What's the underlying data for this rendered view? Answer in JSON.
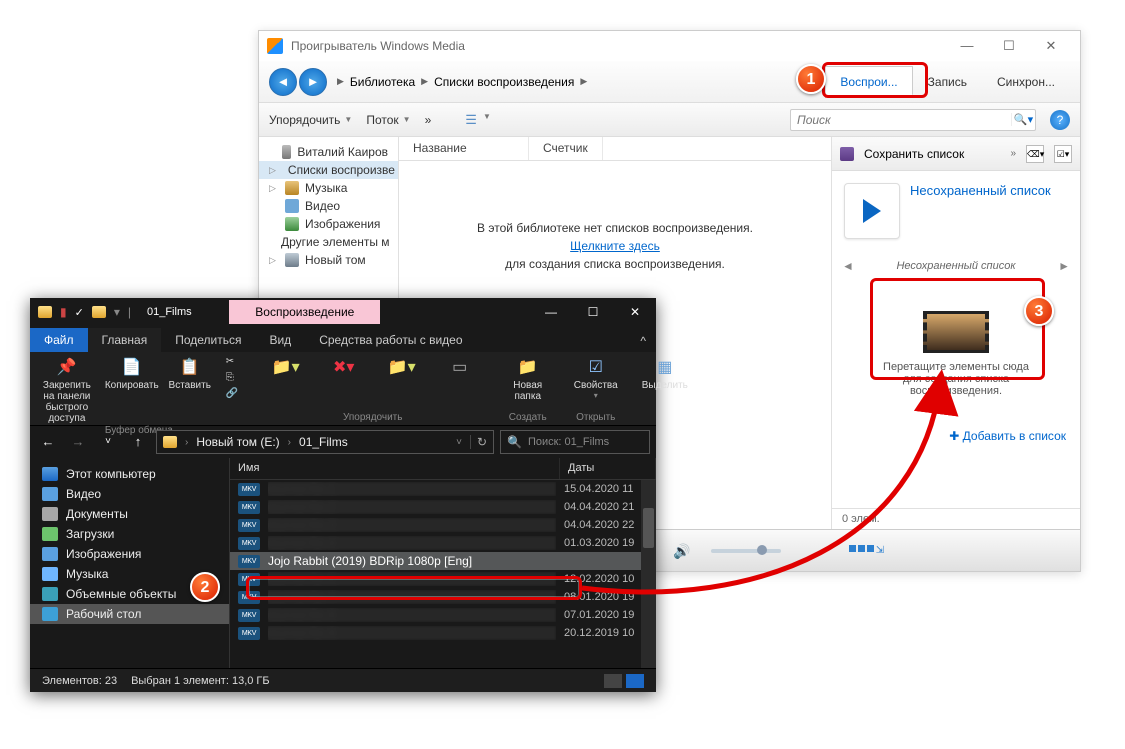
{
  "wmp": {
    "title": "Проигрыватель Windows Media",
    "breadcrumb": [
      "Библиотека",
      "Списки воспроизведения"
    ],
    "tabs": {
      "play": "Воспрои...",
      "burn": "Запись",
      "sync": "Синхрон..."
    },
    "toolbar": {
      "organize": "Упорядочить",
      "stream": "Поток",
      "more": "»",
      "search_ph": "Поиск"
    },
    "tree": {
      "user": "Виталий Каиров",
      "playlists": "Списки воспроизве",
      "music": "Музыка",
      "video": "Видео",
      "images": "Изображения",
      "other": "Другие элементы м",
      "volume": "Новый том"
    },
    "columns": {
      "name": "Название",
      "counter": "Счетчик"
    },
    "empty": {
      "line1": "В этой библиотеке нет списков воспроизведения.",
      "link": "Щелкните здесь",
      "line2": "для создания списка воспроизведения."
    },
    "right": {
      "save": "Сохранить список",
      "title": "Несохраненный список",
      "pager_label": "Несохраненный список",
      "drop1": "Перетащите элементы сюда",
      "drop2": "для создания списка",
      "drop3": "воспроизведения.",
      "add": "Добавить в список",
      "status": "0 элем."
    }
  },
  "explorer": {
    "title": "01_Films",
    "context_tab": "Воспроизведение",
    "tabs": {
      "file": "Файл",
      "home": "Главная",
      "share": "Поделиться",
      "view": "Вид",
      "videotools": "Средства работы с видео"
    },
    "ribbon": {
      "pin": "Закрепить на панели\nбыстрого доступа",
      "copy": "Копировать",
      "paste": "Вставить",
      "clipboard_grp": "Буфер обмена",
      "organize_grp": "Упорядочить",
      "newfolder": "Новая\nпапка",
      "new_grp": "Создать",
      "props": "Свойства",
      "open_grp": "Открыть",
      "select": "Выделить"
    },
    "path": {
      "vol": "Новый том (E:)",
      "folder": "01_Films"
    },
    "search_ph": "Поиск: 01_Films",
    "nav": {
      "this_pc": "Этот компьютер",
      "video": "Видео",
      "docs": "Документы",
      "downloads": "Загрузки",
      "images": "Изображения",
      "music": "Музыка",
      "objects3d": "Объемные объекты",
      "desktop": "Рабочий стол"
    },
    "cols": {
      "name": "Имя",
      "date": "Даты"
    },
    "rows": [
      {
        "name": "blurred-file-1",
        "date": "15.04.2020 11",
        "blur": true
      },
      {
        "name": "blurred-file-2",
        "date": "04.04.2020 21",
        "blur": true
      },
      {
        "name": "blurred-file-3",
        "date": "04.04.2020 22",
        "blur": true
      },
      {
        "name": "blurred-file-4",
        "date": "01.03.2020 19",
        "blur": true
      },
      {
        "name": "Jojo Rabbit (2019) BDRip 1080p [Eng]",
        "date": "",
        "blur": false,
        "sel": true
      },
      {
        "name": "blurred-file-6",
        "date": "12.02.2020 10",
        "blur": true
      },
      {
        "name": "blurred-file-7",
        "date": "08.01.2020 19",
        "blur": true
      },
      {
        "name": "blurred-file-8",
        "date": "07.01.2020 19",
        "blur": true
      },
      {
        "name": "blurred-file-9",
        "date": "20.12.2019 10",
        "blur": true
      }
    ],
    "status": {
      "count": "Элементов: 23",
      "sel": "Выбран 1 элемент: 13,0 ГБ"
    }
  },
  "badges": {
    "b1": "1",
    "b2": "2",
    "b3": "3"
  }
}
